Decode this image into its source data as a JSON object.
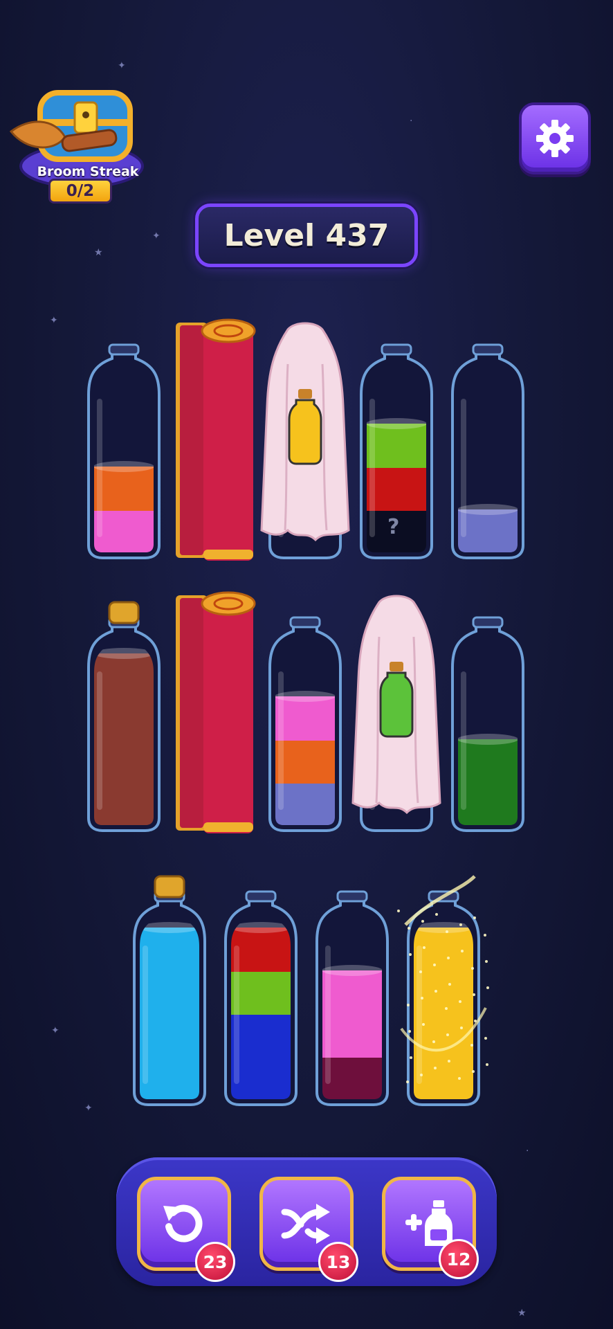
{
  "broom_streak": {
    "label": "Broom Streak",
    "count": "0/2"
  },
  "level": {
    "label": "Level 437"
  },
  "icons": {
    "settings": "gear-icon",
    "undo": "undo-icon",
    "shuffle": "shuffle-icon",
    "add_bottle": "add-bottle-icon"
  },
  "board": {
    "bottles": [
      {
        "id": "r1-b1",
        "state": "open",
        "layers_bottom_to_top": [
          "#ef5bcf",
          "#e8621c"
        ]
      },
      {
        "id": "r1-b2",
        "state": "covered-curtain"
      },
      {
        "id": "r1-b3",
        "state": "covered-cloth",
        "hint_color": "#f6c21d"
      },
      {
        "id": "r1-b4",
        "state": "open",
        "layers_bottom_to_top": [
          "hidden",
          "#c81414",
          "#6fbf1e"
        ],
        "hidden_mark": "?"
      },
      {
        "id": "r1-b5",
        "state": "open",
        "layers_bottom_to_top": [
          "#6c72c7"
        ]
      },
      {
        "id": "r2-b1",
        "state": "corked",
        "layers_bottom_to_top": [
          "#8a3a30",
          "#8a3a30",
          "#8a3a30",
          "#8a3a30"
        ]
      },
      {
        "id": "r2-b2",
        "state": "covered-curtain"
      },
      {
        "id": "r2-b3",
        "state": "open",
        "layers_bottom_to_top": [
          "#6c72c7",
          "#e8621c",
          "#ef5bcf"
        ]
      },
      {
        "id": "r2-b4",
        "state": "covered-cloth",
        "hint_color": "#5cc23a"
      },
      {
        "id": "r2-b5",
        "state": "open",
        "layers_bottom_to_top": [
          "#1f7a1e",
          "#1f7a1e"
        ]
      },
      {
        "id": "r3-b1",
        "state": "corked",
        "layers_bottom_to_top": [
          "#1fb0ec",
          "#1fb0ec",
          "#1fb0ec",
          "#1fb0ec"
        ]
      },
      {
        "id": "r3-b2",
        "state": "open",
        "layers_bottom_to_top": [
          "#1a2dcf",
          "#1a2dcf",
          "#6fbf1e",
          "#c81414"
        ]
      },
      {
        "id": "r3-b3",
        "state": "open",
        "layers_bottom_to_top": [
          "#6e0f3c",
          "#ef5bcf",
          "#ef5bcf"
        ]
      },
      {
        "id": "r3-b4",
        "state": "open",
        "layers_bottom_to_top": [
          "#f6c21d",
          "#f6c21d",
          "#f6c21d",
          "#f6c21d"
        ],
        "sparkle": true
      }
    ]
  },
  "toolbar": {
    "undo": {
      "count": "23"
    },
    "shuffle": {
      "count": "13"
    },
    "add_bottle": {
      "count": "12"
    }
  }
}
